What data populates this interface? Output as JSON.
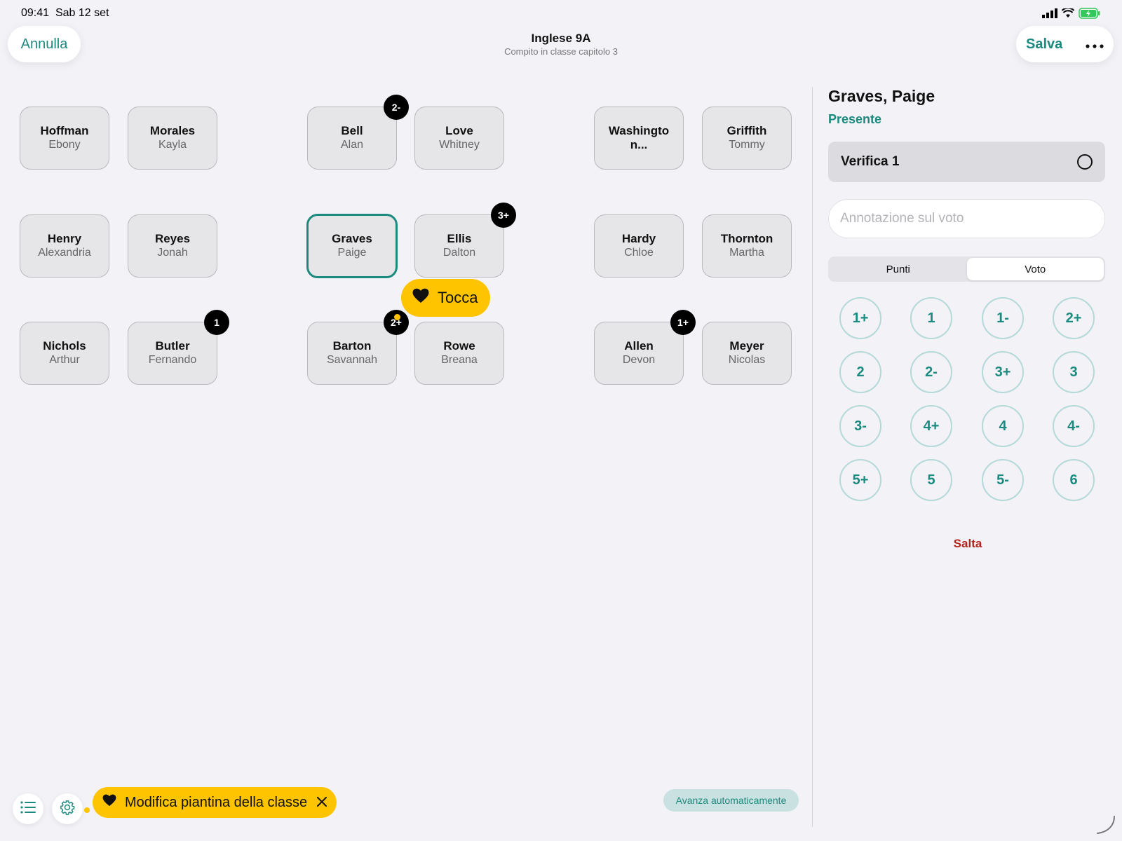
{
  "status_bar": {
    "time": "09:41",
    "date": "Sab 12 set"
  },
  "header": {
    "cancel_label": "Annulla",
    "title": "Inglese 9A",
    "subtitle": "Compito in classe capitolo 3",
    "save_label": "Salva",
    "more_icon": "ellipsis-icon"
  },
  "seats": [
    {
      "last": "Hoffman",
      "first": "Ebony",
      "badge": ""
    },
    {
      "last": "Morales",
      "first": "Kayla",
      "badge": ""
    },
    {
      "last": "Bell",
      "first": "Alan",
      "badge": "2-"
    },
    {
      "last": "Love",
      "first": "Whitney",
      "badge": ""
    },
    {
      "last": "Washingto n...",
      "first": "",
      "badge": ""
    },
    {
      "last": "Griffith",
      "first": "Tommy",
      "badge": ""
    },
    {
      "last": "Henry",
      "first": "Alexandria",
      "badge": ""
    },
    {
      "last": "Reyes",
      "first": "Jonah",
      "badge": ""
    },
    {
      "last": "Graves",
      "first": "Paige",
      "badge": "",
      "selected": true
    },
    {
      "last": "Ellis",
      "first": "Dalton",
      "badge": "3+"
    },
    {
      "last": "Hardy",
      "first": "Chloe",
      "badge": ""
    },
    {
      "last": "Thornton",
      "first": "Martha",
      "badge": ""
    },
    {
      "last": "Nichols",
      "first": "Arthur",
      "badge": ""
    },
    {
      "last": "Butler",
      "first": "Fernando",
      "badge": "1"
    },
    {
      "last": "Barton",
      "first": "Savannah",
      "badge": "2+"
    },
    {
      "last": "Rowe",
      "first": "Breana",
      "badge": ""
    },
    {
      "last": "Allen",
      "first": "Devon",
      "badge": "1+"
    },
    {
      "last": "Meyer",
      "first": "Nicolas",
      "badge": ""
    }
  ],
  "tip_bubble": {
    "icon": "heart-icon",
    "label": "Tocca"
  },
  "panel": {
    "student_name": "Graves, Paige",
    "status": "Presente",
    "assessment_label": "Verifica 1",
    "note_placeholder": "Annotazione sul voto",
    "segments": [
      "Punti",
      "Voto"
    ],
    "active_segment": "Voto",
    "grades": [
      "1+",
      "1",
      "1-",
      "2+",
      "2",
      "2-",
      "3+",
      "3",
      "3-",
      "4+",
      "4",
      "4-",
      "5+",
      "5",
      "5-",
      "6"
    ],
    "skip_label": "Salta"
  },
  "footer": {
    "auto_advance_label": "Avanza automaticamente",
    "list_icon": "list-icon",
    "settings_icon": "gear-icon",
    "tip_icon": "heart-icon",
    "tip_label": "Modifica piantina della classe",
    "tip_close_icon": "close-icon"
  },
  "colors": {
    "accent": "#1b8a7f",
    "background": "#f2f2f7",
    "tip": "#ffc400",
    "skip": "#b3261e",
    "badge": "#000000"
  }
}
